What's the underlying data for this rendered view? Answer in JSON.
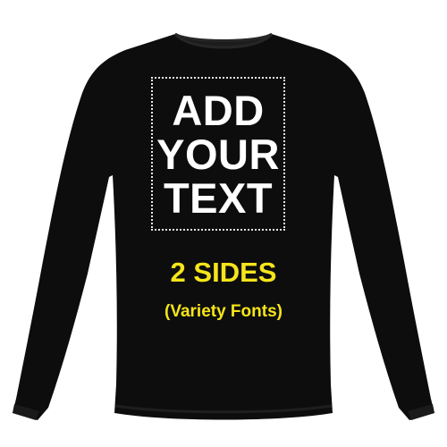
{
  "print": {
    "lines": [
      "ADD",
      "YOUR",
      "TEXT"
    ]
  },
  "sides_label": "2 SIDES",
  "fonts_label": "(Variety Fonts)",
  "colors": {
    "shirt": "#0d0d0d",
    "print_text": "#ffffff",
    "accent_text": "#f5e51a",
    "background": "#ffffff"
  }
}
